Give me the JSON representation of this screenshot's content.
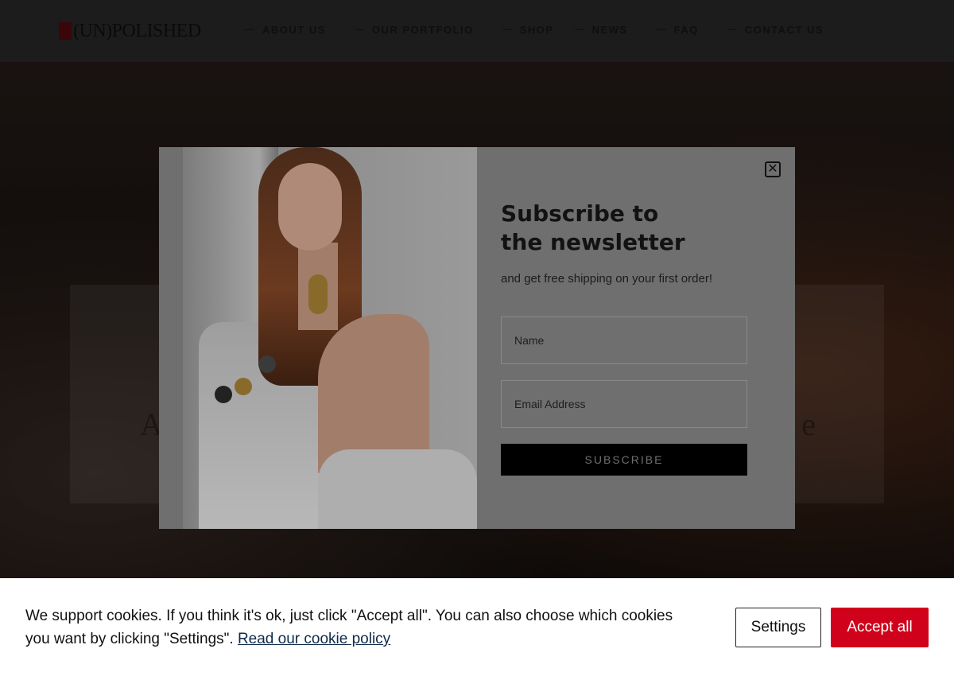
{
  "site": {
    "logo_text": "(UN)POLISHED",
    "nav": [
      {
        "label": "ABOUT US"
      },
      {
        "label": "OUR PORTFOLIO"
      },
      {
        "label": "SHOP"
      },
      {
        "label": "NEWS"
      },
      {
        "label": "FAQ"
      },
      {
        "label": "CONTACT US"
      }
    ],
    "hero_heading_left": "A",
    "hero_heading_right": "e"
  },
  "newsletter": {
    "title_line1": "Subscribe to",
    "title_line2": "the newsletter",
    "subtitle": "and get free shipping on your first order!",
    "name_placeholder": "Name",
    "email_placeholder": "Email Address",
    "subscribe_label": "SUBSCRIBE",
    "close_symbol": "✕"
  },
  "cookie_bar": {
    "text": "We support cookies. If you think it's ok, just click \"Accept all\". You can also choose which cookies you want by clicking \"Settings\".",
    "link_text": "Read our cookie policy",
    "settings_label": "Settings",
    "accept_label": "Accept all"
  },
  "colors": {
    "accent": "#d0021b",
    "overlay_modal": "#6f6f6f",
    "button_dark": "#000000"
  }
}
